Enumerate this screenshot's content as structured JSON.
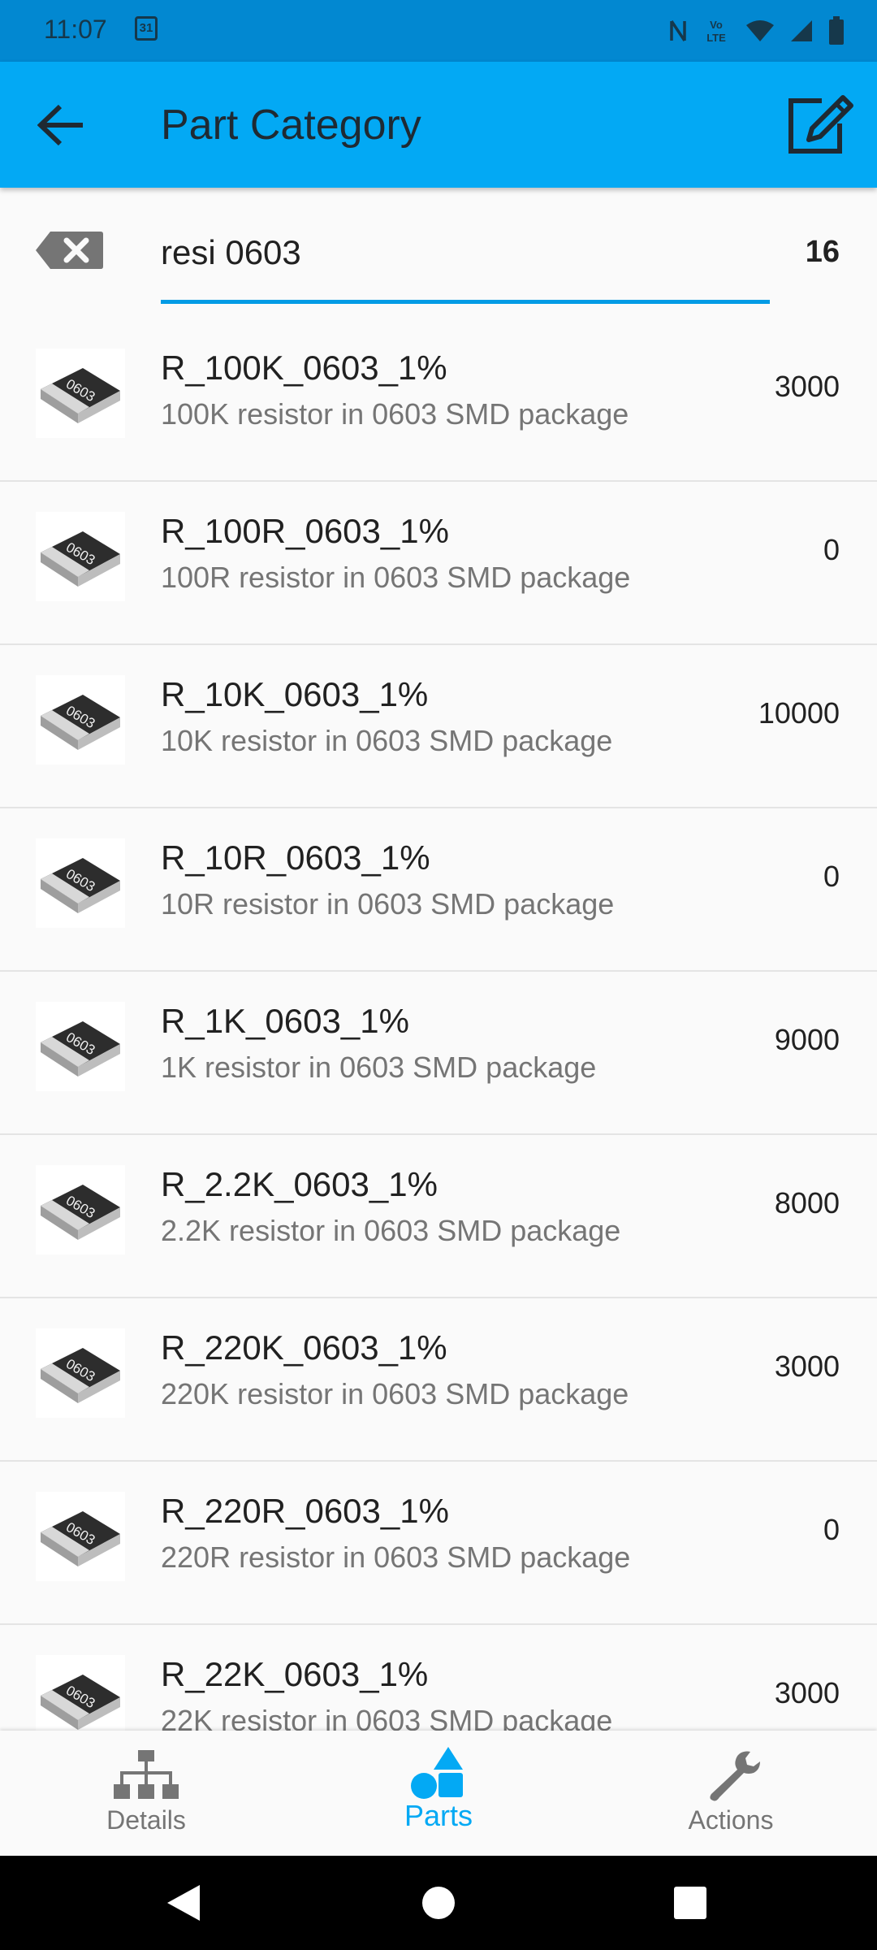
{
  "status": {
    "time": "11:07",
    "calendar_day": "31"
  },
  "app_bar": {
    "title": "Part Category"
  },
  "search": {
    "query": "resi 0603",
    "count": "16"
  },
  "parts": [
    {
      "name": "R_100K_0603_1%",
      "description": "100K resistor in 0603 SMD package",
      "quantity": "3000",
      "thumb_label": "0603"
    },
    {
      "name": "R_100R_0603_1%",
      "description": "100R resistor in 0603 SMD package",
      "quantity": "0",
      "thumb_label": "0603"
    },
    {
      "name": "R_10K_0603_1%",
      "description": "10K resistor in 0603 SMD package",
      "quantity": "10000",
      "thumb_label": "0603"
    },
    {
      "name": "R_10R_0603_1%",
      "description": "10R resistor in 0603 SMD package",
      "quantity": "0",
      "thumb_label": "0603"
    },
    {
      "name": "R_1K_0603_1%",
      "description": "1K resistor in 0603 SMD package",
      "quantity": "9000",
      "thumb_label": "0603"
    },
    {
      "name": "R_2.2K_0603_1%",
      "description": "2.2K resistor in 0603 SMD package",
      "quantity": "8000",
      "thumb_label": "0603"
    },
    {
      "name": "R_220K_0603_1%",
      "description": "220K resistor in 0603 SMD package",
      "quantity": "3000",
      "thumb_label": "0603"
    },
    {
      "name": "R_220R_0603_1%",
      "description": "220R resistor in 0603 SMD package",
      "quantity": "0",
      "thumb_label": "0603"
    },
    {
      "name": "R_22K_0603_1%",
      "description": "22K resistor in 0603 SMD package",
      "quantity": "3000",
      "thumb_label": "0603"
    }
  ],
  "bottom_nav": [
    {
      "label": "Details",
      "icon": "hierarchy-icon",
      "active": false
    },
    {
      "label": "Parts",
      "icon": "shapes-icon",
      "active": true
    },
    {
      "label": "Actions",
      "icon": "wrench-icon",
      "active": false
    }
  ],
  "colors": {
    "status_bar": "#0288d1",
    "app_bar": "#03a9f4",
    "accent": "#03a9f4",
    "underline": "#039be5"
  }
}
